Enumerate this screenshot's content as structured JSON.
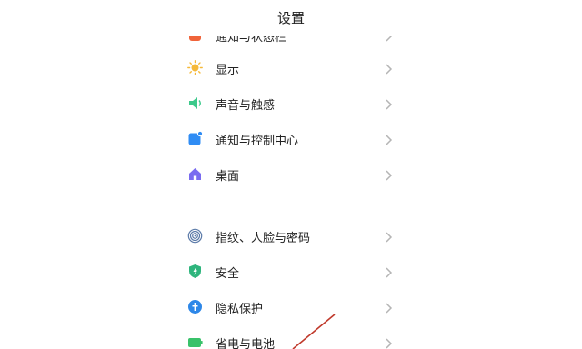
{
  "header": {
    "title": "设置"
  },
  "settings": {
    "items": [
      {
        "label": "通知与状态栏",
        "icon": "notification-status-icon",
        "color": "#f0643a"
      },
      {
        "label": "显示",
        "icon": "sun-icon",
        "color": "#f5b93a"
      },
      {
        "label": "声音与触感",
        "icon": "speaker-icon",
        "color": "#3cc98b"
      },
      {
        "label": "通知与控制中心",
        "icon": "notification-icon",
        "color": "#2f8cf4"
      },
      {
        "label": "桌面",
        "icon": "home-icon",
        "color": "#7a6cf0"
      },
      {
        "label": "指纹、人脸与密码",
        "icon": "fingerprint-icon",
        "color": "#5b7aa8"
      },
      {
        "label": "安全",
        "icon": "shield-icon",
        "color": "#2fb57d"
      },
      {
        "label": "隐私保护",
        "icon": "privacy-icon",
        "color": "#2d87e8"
      },
      {
        "label": "省电与电池",
        "icon": "battery-icon",
        "color": "#39c26a"
      }
    ]
  },
  "colors": {
    "annotation_arrow": "#c0392b"
  }
}
